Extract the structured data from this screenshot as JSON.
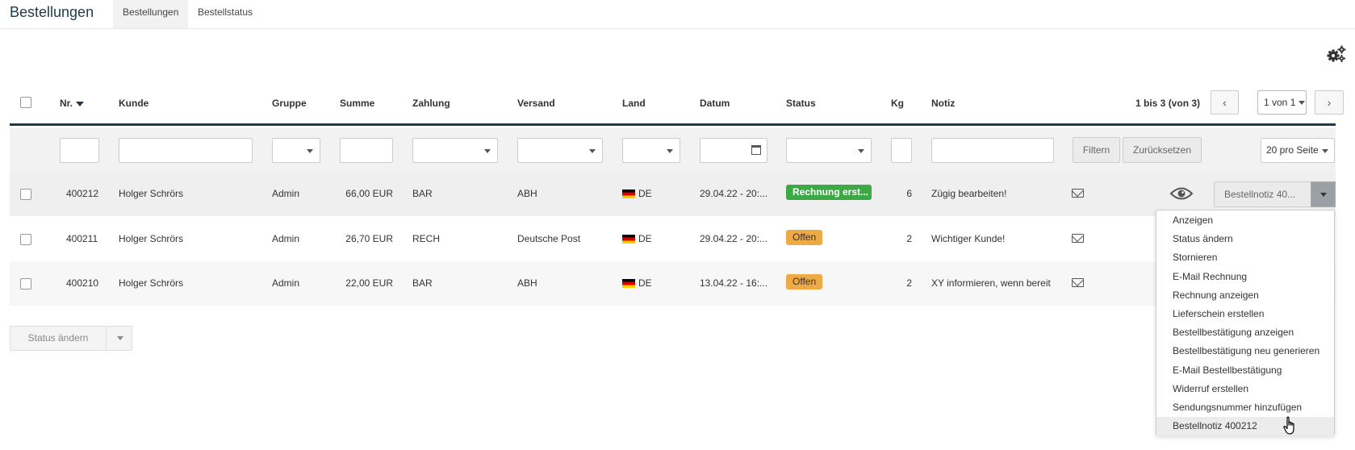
{
  "header": {
    "title": "Bestellungen",
    "tabs": [
      {
        "label": "Bestellungen",
        "active": true
      },
      {
        "label": "Bestellstatus",
        "active": false
      }
    ]
  },
  "settings_icon": "gears-icon",
  "table": {
    "columns": {
      "nr": "Nr.",
      "kunde": "Kunde",
      "gruppe": "Gruppe",
      "summe": "Summe",
      "zahlung": "Zahlung",
      "versand": "Versand",
      "land": "Land",
      "datum": "Datum",
      "status": "Status",
      "kg": "Kg",
      "notiz": "Notiz"
    },
    "pager": {
      "summary": "1 bis 3 (von 3)",
      "prev": "‹",
      "next": "›",
      "page_select": "1 von 1"
    },
    "filter": {
      "filter_button": "Filtern",
      "reset_button": "Zurücksetzen",
      "per_page": "20 pro Seite"
    },
    "rows": [
      {
        "nr": "400212",
        "kunde": "Holger Schrörs",
        "gruppe": "Admin",
        "summe": "66,00 EUR",
        "zahlung": "BAR",
        "versand": "ABH",
        "land": "DE",
        "datum": "29.04.22 - 20:...",
        "status": "Rechnung erst...",
        "status_color": "#3da944",
        "kg": "6",
        "notiz": "Zügig bearbeiten!"
      },
      {
        "nr": "400211",
        "kunde": "Holger Schrörs",
        "gruppe": "Admin",
        "summe": "26,70 EUR",
        "zahlung": "RECH",
        "versand": "Deutsche Post",
        "land": "DE",
        "datum": "29.04.22 - 20:...",
        "status": "Offen",
        "status_color": "#eeaa45",
        "kg": "2",
        "notiz": "Wichtiger Kunde!"
      },
      {
        "nr": "400210",
        "kunde": "Holger Schrörs",
        "gruppe": "Admin",
        "summe": "22,00 EUR",
        "zahlung": "BAR",
        "versand": "ABH",
        "land": "DE",
        "datum": "13.04.22 - 16:...",
        "status": "Offen",
        "status_color": "#eeaa45",
        "kg": "2",
        "notiz": "XY informieren, wenn bereit"
      }
    ],
    "row_action": {
      "note_button": "Bestellnotiz 40..."
    }
  },
  "action_menu": {
    "items": [
      "Anzeigen",
      "Status ändern",
      "Stornieren",
      "E-Mail Rechnung",
      "Rechnung anzeigen",
      "Lieferschein erstellen",
      "Bestellbestätigung anzeigen",
      "Bestellbestätigung neu generieren",
      "E-Mail Bestellbestätigung",
      "Widerruf erstellen",
      "Sendungsnummer hinzufügen",
      "Bestellnotiz 400212"
    ],
    "hovered_index": 11
  },
  "bulk": {
    "label": "Status ändern"
  }
}
